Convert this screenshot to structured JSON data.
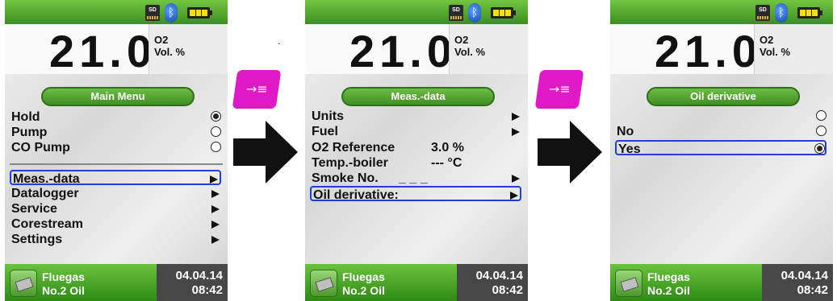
{
  "reading": {
    "value": "21.0",
    "gas": "O2",
    "unit": "Vol. %"
  },
  "status_icons": [
    "sd-card-icon",
    "bluetooth-icon",
    "battery-icon"
  ],
  "sd_label": "SD",
  "keys": {
    "enter_glyph": "→≡"
  },
  "footer": {
    "program_line1": "Fluegas",
    "program_line2": "No.2 Oil",
    "date": "04.04.14",
    "time": "08:42"
  },
  "screens": {
    "main_menu": {
      "title": "Main Menu",
      "toggles": [
        {
          "label": "Hold",
          "checked": true
        },
        {
          "label": "Pump",
          "checked": false
        },
        {
          "label": "CO Pump",
          "checked": false
        }
      ],
      "items": [
        "Meas.-data",
        "Datalogger",
        "Service",
        "Corestream",
        "Settings"
      ],
      "selected": "Meas.-data"
    },
    "meas_data": {
      "title": "Meas.-data",
      "rows": [
        {
          "label": "Units",
          "value": ""
        },
        {
          "label": "Fuel",
          "value": ""
        },
        {
          "label": "O2 Reference",
          "value": "3.0 %"
        },
        {
          "label": "Temp.-boiler",
          "value": "--- °C"
        },
        {
          "label": "Smoke No.",
          "value": "_ _ _"
        },
        {
          "label": "Oil derivative:",
          "value": ""
        }
      ],
      "selected": "Oil derivative:"
    },
    "oil_derivative": {
      "title": "Oil derivative",
      "options": [
        {
          "label": "",
          "checked": false
        },
        {
          "label": "No",
          "checked": false
        },
        {
          "label": "Yes",
          "checked": true
        }
      ],
      "selected": "Yes"
    }
  },
  "colors": {
    "accent_green": "#4aa62a",
    "key_magenta": "#e019c7",
    "select_blue": "#2040d0"
  }
}
